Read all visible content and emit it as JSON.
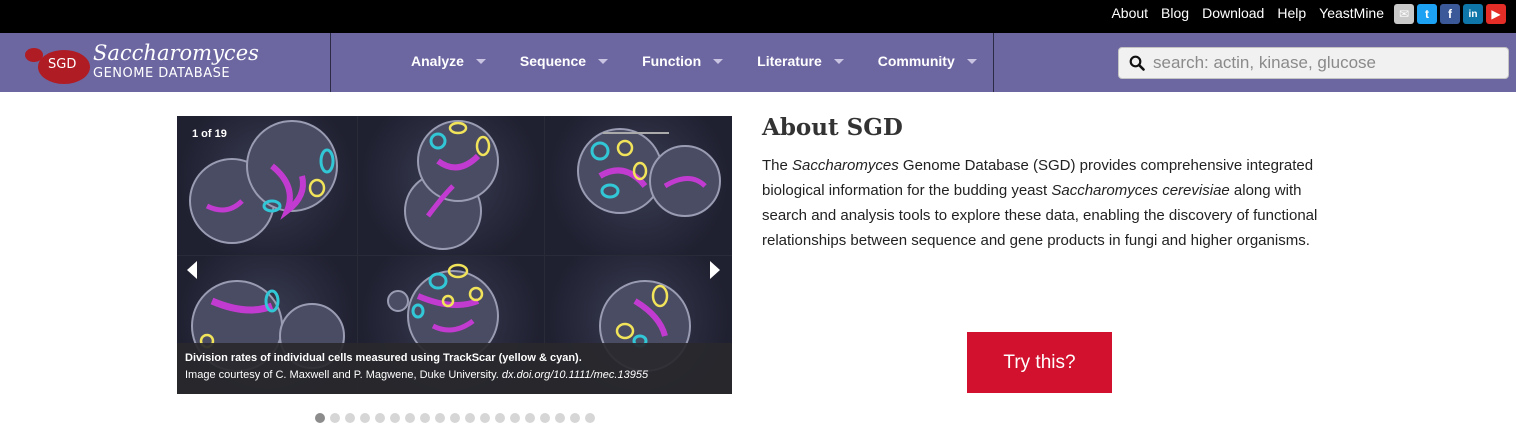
{
  "topbar": {
    "links": [
      "About",
      "Blog",
      "Download",
      "Help",
      "YeastMine"
    ],
    "social": {
      "mail_glyph": "✉",
      "twitter_glyph": "t",
      "facebook_glyph": "f",
      "linkedin_glyph": "in",
      "youtube_glyph": "▶"
    }
  },
  "logo": {
    "badge": "SGD",
    "line1": "Saccharomyces",
    "line2": "GENOME DATABASE"
  },
  "nav": {
    "items": [
      "Analyze",
      "Sequence",
      "Function",
      "Literature",
      "Community"
    ]
  },
  "search": {
    "placeholder": "search: actin, kinase, glucose",
    "icon": "search-icon"
  },
  "carousel": {
    "counter": "1  of  19",
    "caption_title": "Division rates of individual cells measured using TrackScar (yellow & cyan).",
    "caption_credit": "Image courtesy of C. Maxwell and P. Magwene, Duke University. ",
    "caption_doi": "dx.doi.org/10.1111/mec.13955",
    "slide_count": 19,
    "active_slide": 1
  },
  "about": {
    "title": "About SGD",
    "p_part1": "The ",
    "p_em1": "Saccharomyces",
    "p_part2": " Genome Database (SGD) provides comprehensive integrated biological information for the budding yeast ",
    "p_em2": "Saccharomyces cerevisiae",
    "p_part3": " along with search and analysis tools to explore these data, enabling the discovery of functional relationships between sequence and gene products in fungi and higher organisms.",
    "button": "Try this?"
  },
  "colors": {
    "topbar": "#000000",
    "navbar": "#6c66a1",
    "logo_red": "#b01c23",
    "try_button": "#d1112d"
  }
}
